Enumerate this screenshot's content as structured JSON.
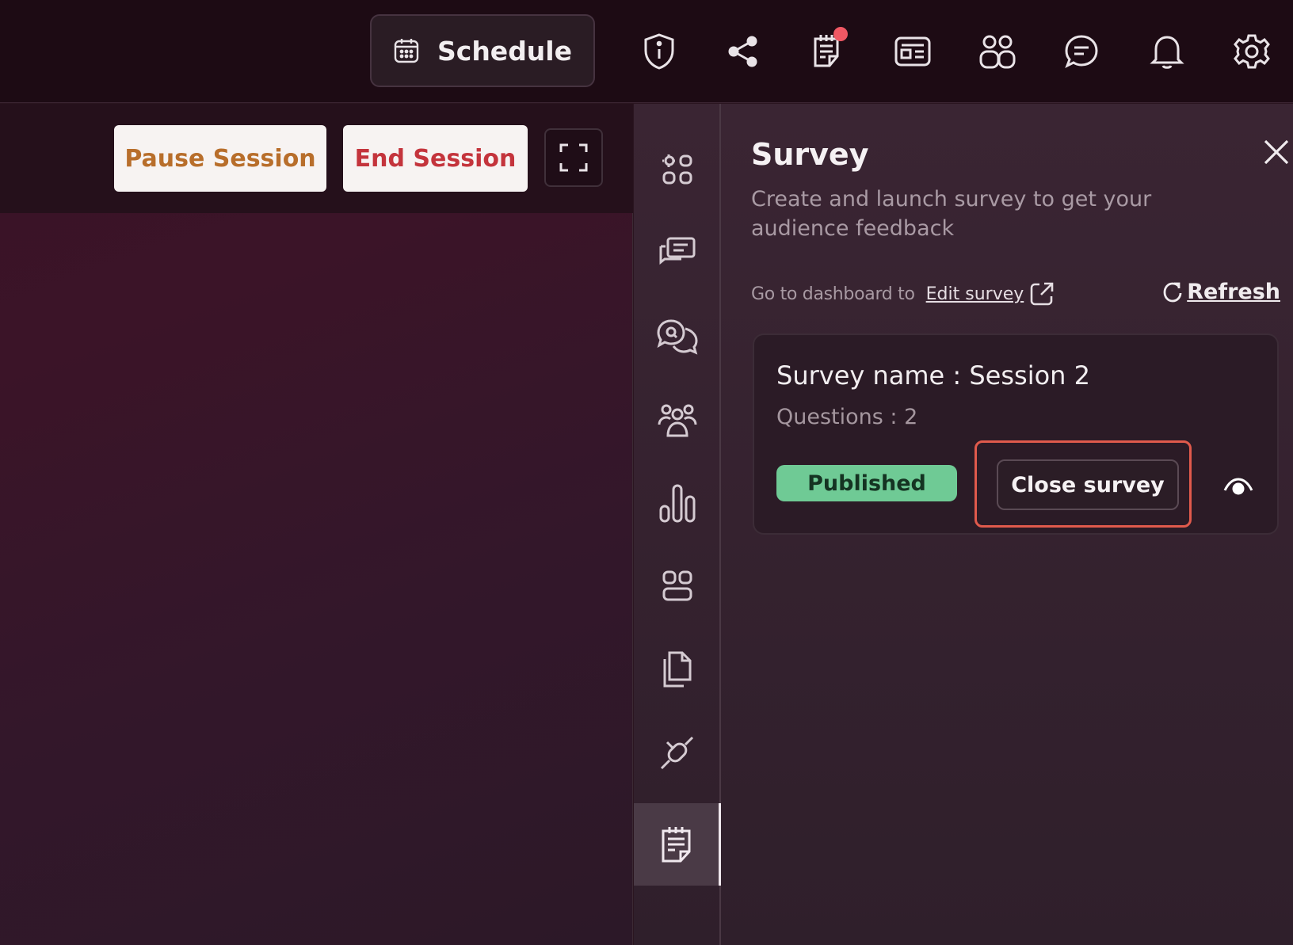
{
  "topbar": {
    "schedule_label": "Schedule",
    "icons": [
      "shield-info-icon",
      "share-icon",
      "notes-icon",
      "news-icon",
      "people-icon",
      "chat-icon",
      "bell-icon",
      "gear-icon"
    ],
    "notification_color": "#f05864"
  },
  "session": {
    "pause_label": "Pause Session",
    "pause_color": "#b86e2b",
    "end_label": "End Session",
    "end_color": "#c4343c"
  },
  "rail": {
    "items": [
      "apps-icon",
      "presentation-chat-icon",
      "qa-icon",
      "group-icon",
      "poll-chart-icon",
      "layout-icon",
      "files-icon",
      "plugin-icon",
      "survey-icon"
    ],
    "active": "survey-icon"
  },
  "panel": {
    "title": "Survey",
    "description": "Create and launch survey to get your audience feedback",
    "dashboard_text": "Go to dashboard to",
    "edit_link": "Edit survey",
    "refresh_label": "Refresh"
  },
  "survey": {
    "name": "Survey name : Session 2",
    "questions": "Questions : 2",
    "status": "Published",
    "status_color": "#6fca95",
    "close_label": "Close survey",
    "highlight_color": "#e05a4c"
  }
}
